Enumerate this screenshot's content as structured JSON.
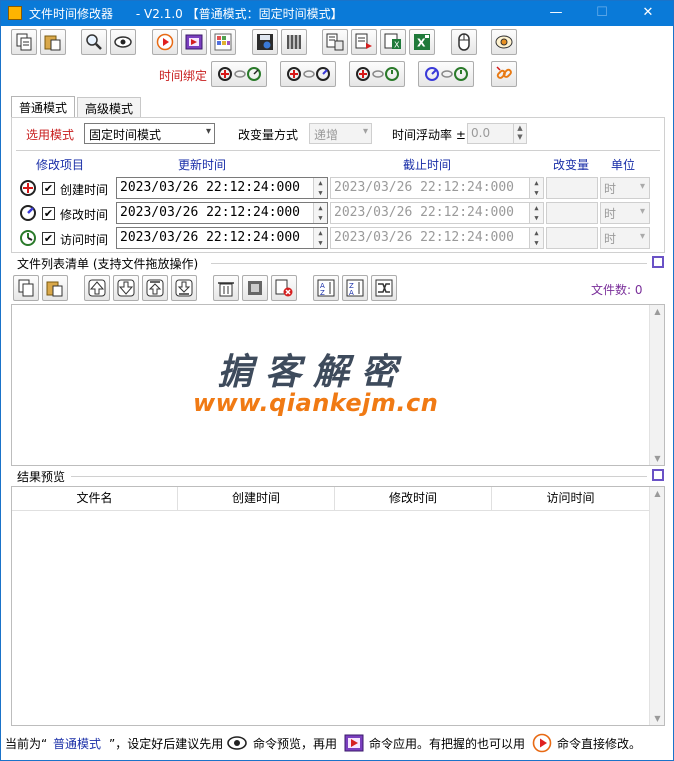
{
  "window": {
    "title": "文件时间修改器      - V2.1.0 【普通模式：固定时间模式】",
    "min": "—",
    "max": "☐",
    "close": "✕"
  },
  "toolbar": {
    "icons": [
      "copy-files-icon",
      "paste-files-icon",
      "search-icon",
      "preview-eye-icon",
      "play-icon",
      "film-apply-icon",
      "grid-icon",
      "save-disk-icon",
      "archive-icon",
      "copy-list-icon",
      "export-icon",
      "excel-icon",
      "excel-export-icon",
      "mouse-icon",
      "eye-target-icon"
    ],
    "bind_label": "时间绑定",
    "bind_icons": [
      "bind-create-icon",
      "bind-modify-icon",
      "bind-access-icon",
      "bind-all-icon",
      "unlink-icon"
    ]
  },
  "tabs": [
    {
      "label": "普通模式"
    },
    {
      "label": "高级模式"
    }
  ],
  "settings": {
    "mode_label": "选用模式",
    "mode_value": "固定时间模式",
    "change_mode_label": "改变量方式",
    "change_mode_value": "递增",
    "float_label": "时间浮动率 ±",
    "float_value": "0.0"
  },
  "grid_headers": {
    "item": "修改项目",
    "update": "更新时间",
    "end": "截止时间",
    "delta": "改变量",
    "unit": "单位"
  },
  "rows": [
    {
      "label": "创建时间",
      "checked": "✔",
      "update_time": "2023/03/26 22:12:24:000",
      "end_time": "2023/03/26 22:12:24:000",
      "unit": "时"
    },
    {
      "label": "修改时间",
      "checked": "✔",
      "update_time": "2023/03/26 22:12:24:000",
      "end_time": "2023/03/26 22:12:24:000",
      "unit": "时"
    },
    {
      "label": "访问时间",
      "checked": "✔",
      "update_time": "2023/03/26 22:12:24:000",
      "end_time": "2023/03/26 22:12:24:000",
      "unit": "时"
    }
  ],
  "filelist": {
    "title": "文件列表清单 (支持文件拖放操作)",
    "count_label": "文件数: 0",
    "watermark_cn": "掮客解密",
    "watermark_url": "www.qiankejm.cn"
  },
  "results": {
    "title": "结果预览",
    "columns": [
      "文件名",
      "创建时间",
      "修改时间",
      "访问时间"
    ]
  },
  "status": {
    "p1": "当前为“",
    "mode": "普通模式",
    "p2": "”，设定好后建议先用",
    "p3": "命令预览，再用",
    "p4": "命令应用。有把握的也可以用",
    "p5": "命令直接修改。"
  },
  "colors": {
    "titlebar": "#0a7ad8",
    "label_red": "#c81e1e",
    "label_blue": "#1a2fa8",
    "count_purple": "#7a2f9a",
    "watermark_dark": "#3e4b5c",
    "watermark_orange": "#f07a14"
  }
}
